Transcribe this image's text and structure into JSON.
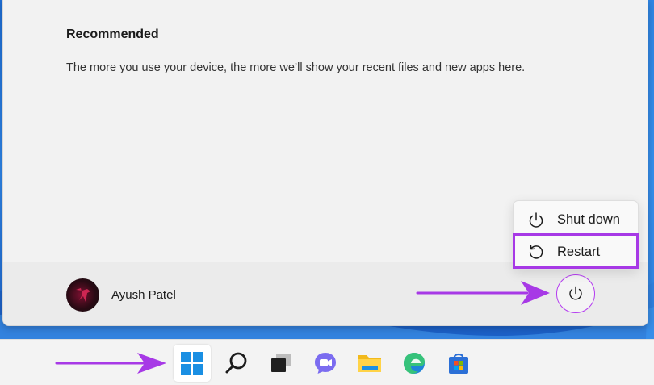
{
  "start_menu": {
    "recommended": {
      "title": "Recommended",
      "description": "The more you use your device, the more we’ll show your recent files and new apps here."
    },
    "user": {
      "name": "Ayush Patel"
    },
    "power_menu": {
      "items": [
        {
          "label": "Shut down",
          "icon": "power-icon"
        },
        {
          "label": "Restart",
          "icon": "restart-icon",
          "highlighted": true
        }
      ]
    },
    "power_button": {
      "icon": "power-icon"
    }
  },
  "taskbar": {
    "items": [
      {
        "name": "start",
        "icon": "windows-logo-icon"
      },
      {
        "name": "search",
        "icon": "search-icon"
      },
      {
        "name": "task-view",
        "icon": "task-view-icon"
      },
      {
        "name": "chat",
        "icon": "teams-chat-icon"
      },
      {
        "name": "file-explorer",
        "icon": "folder-icon"
      },
      {
        "name": "edge",
        "icon": "edge-icon"
      },
      {
        "name": "store",
        "icon": "store-icon"
      }
    ]
  },
  "annotations": {
    "accent_color": "#a739e6"
  }
}
